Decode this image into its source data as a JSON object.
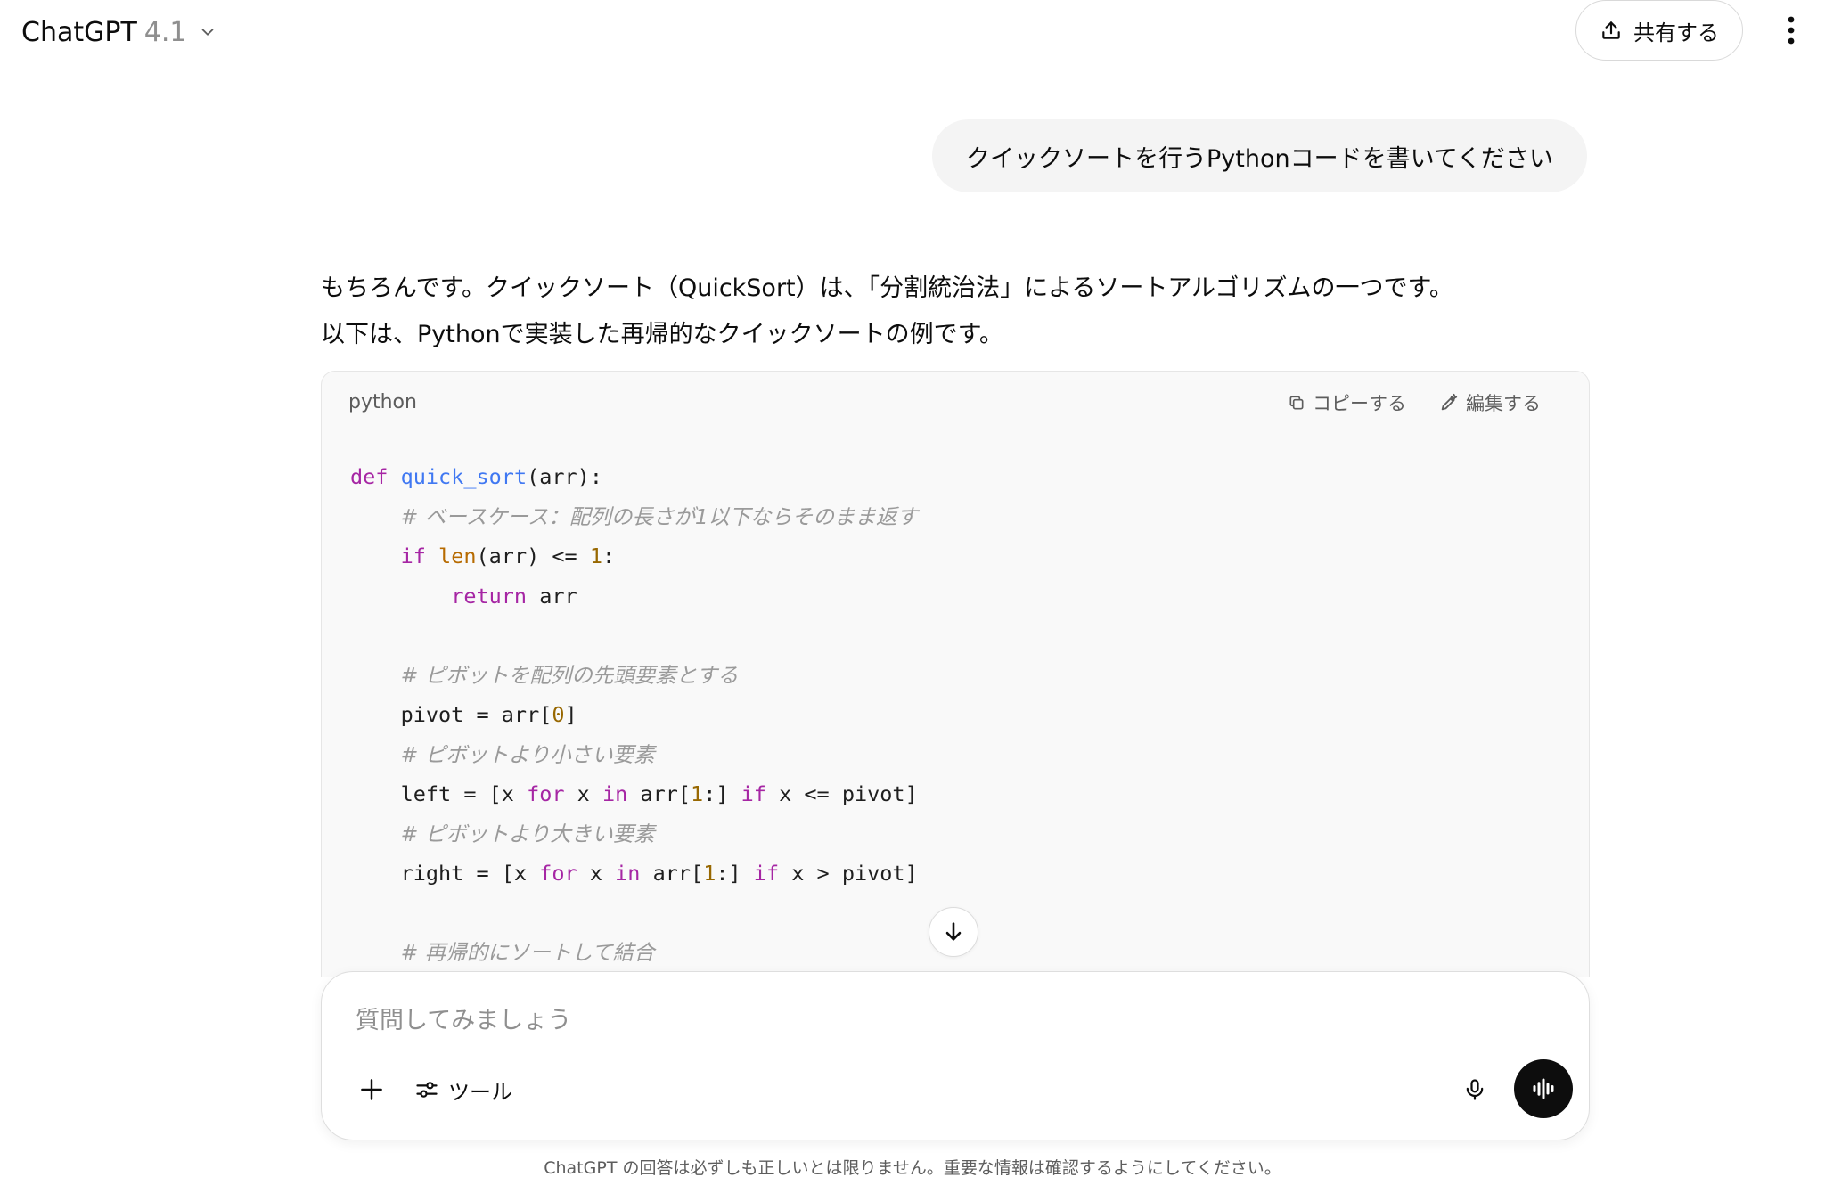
{
  "header": {
    "model_name": "ChatGPT",
    "model_version": "4.1",
    "share_label": "共有する"
  },
  "conversation": {
    "user_message": "クイックソートを行うPythonコードを書いてください",
    "assistant_intro": [
      "もちろんです。クイックソート（QuickSort）は、「分割統治法」によるソートアルゴリズムの一つです。",
      "以下は、Pythonで実装した再帰的なクイックソートの例です。"
    ],
    "code_block": {
      "language": "python",
      "copy_label": "コピーする",
      "edit_label": "編集する",
      "lines": [
        [
          {
            "t": "def",
            "c": "kw"
          },
          {
            "t": " "
          },
          {
            "t": "quick_sort",
            "c": "fn"
          },
          {
            "t": "(arr):"
          }
        ],
        [
          {
            "t": "    "
          },
          {
            "t": "# ベースケース：配列の長さが1以下ならそのまま返す",
            "c": "cm"
          }
        ],
        [
          {
            "t": "    "
          },
          {
            "t": "if",
            "c": "kw"
          },
          {
            "t": " "
          },
          {
            "t": "len",
            "c": "bi"
          },
          {
            "t": "(arr) <= "
          },
          {
            "t": "1",
            "c": "num"
          },
          {
            "t": ":"
          }
        ],
        [
          {
            "t": "        "
          },
          {
            "t": "return",
            "c": "kw"
          },
          {
            "t": " arr"
          }
        ],
        [],
        [
          {
            "t": "    "
          },
          {
            "t": "# ピボットを配列の先頭要素とする",
            "c": "cm"
          }
        ],
        [
          {
            "t": "    pivot = arr["
          },
          {
            "t": "0",
            "c": "num"
          },
          {
            "t": "]"
          }
        ],
        [
          {
            "t": "    "
          },
          {
            "t": "# ピボットより小さい要素",
            "c": "cm"
          }
        ],
        [
          {
            "t": "    left = [x "
          },
          {
            "t": "for",
            "c": "kw"
          },
          {
            "t": " x "
          },
          {
            "t": "in",
            "c": "kw"
          },
          {
            "t": " arr["
          },
          {
            "t": "1",
            "c": "num"
          },
          {
            "t": ":] "
          },
          {
            "t": "if",
            "c": "kw"
          },
          {
            "t": " x <= pivot]"
          }
        ],
        [
          {
            "t": "    "
          },
          {
            "t": "# ピボットより大きい要素",
            "c": "cm"
          }
        ],
        [
          {
            "t": "    right = [x "
          },
          {
            "t": "for",
            "c": "kw"
          },
          {
            "t": " x "
          },
          {
            "t": "in",
            "c": "kw"
          },
          {
            "t": " arr["
          },
          {
            "t": "1",
            "c": "num"
          },
          {
            "t": ":] "
          },
          {
            "t": "if",
            "c": "kw"
          },
          {
            "t": " x > pivot]"
          }
        ],
        [],
        [
          {
            "t": "    "
          },
          {
            "t": "# 再帰的にソートして結合",
            "c": "cm"
          }
        ]
      ]
    }
  },
  "composer": {
    "placeholder": "質問してみましょう",
    "tools_label": "ツール"
  },
  "footer": {
    "disclaimer": "ChatGPT の回答は必ずしも正しいとは限りません。重要な情報は確認するようにしてください。"
  },
  "icons": {
    "model_chevron": "chevron-down-icon",
    "share": "upload-icon",
    "more": "more-vertical-icon",
    "copy": "copy-icon",
    "edit": "edit-icon",
    "scroll_down": "arrow-down-icon",
    "add": "plus-icon",
    "tools": "sliders-icon",
    "mic": "microphone-icon",
    "voice": "voice-waveform-icon"
  },
  "colors": {
    "keyword": "#a626a4",
    "function": "#4078f2",
    "builtin": "#b76b01",
    "number": "#986801",
    "comment": "#9a9a9a",
    "user_bubble": "#f4f4f4",
    "code_background": "#f9f9f9"
  }
}
